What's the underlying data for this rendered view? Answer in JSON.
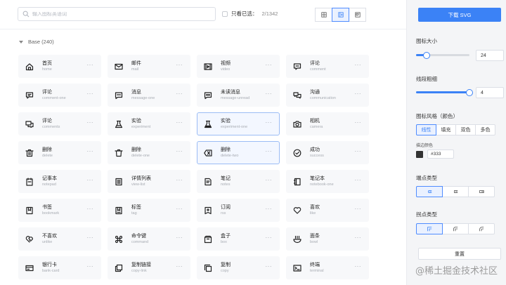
{
  "search": {
    "placeholder": "输入图标英语词"
  },
  "filter": {
    "only_selected_label": "只看已选：",
    "count": "2/1342"
  },
  "group": {
    "title": "Base (240)"
  },
  "icons": [
    {
      "zh": "首页",
      "en": "home",
      "icon": "home-icon",
      "highlight": false
    },
    {
      "zh": "邮件",
      "en": "mail",
      "icon": "mail-icon",
      "highlight": false
    },
    {
      "zh": "视频",
      "en": "video",
      "icon": "video-icon",
      "highlight": false
    },
    {
      "zh": "评论",
      "en": "comment",
      "icon": "comment-icon",
      "highlight": false
    },
    {
      "zh": "评论",
      "en": "comment-one",
      "icon": "comment-one-icon",
      "highlight": false
    },
    {
      "zh": "消息",
      "en": "message-one",
      "icon": "message-one-icon",
      "highlight": false
    },
    {
      "zh": "未读消息",
      "en": "message-unread",
      "icon": "message-unread-icon",
      "highlight": false
    },
    {
      "zh": "沟通",
      "en": "communication",
      "icon": "communication-icon",
      "highlight": false
    },
    {
      "zh": "评论",
      "en": "comments",
      "icon": "comments-icon",
      "highlight": false
    },
    {
      "zh": "实验",
      "en": "experiment",
      "icon": "experiment-icon",
      "highlight": false
    },
    {
      "zh": "实验",
      "en": "experiment-one",
      "icon": "experiment-one-icon",
      "highlight": true
    },
    {
      "zh": "相机",
      "en": "camera",
      "icon": "camera-icon",
      "highlight": false
    },
    {
      "zh": "删除",
      "en": "delete",
      "icon": "delete-icon",
      "highlight": false
    },
    {
      "zh": "删除",
      "en": "delete-one",
      "icon": "delete-one-icon",
      "highlight": false
    },
    {
      "zh": "删除",
      "en": "delete-two",
      "icon": "delete-two-icon",
      "highlight": true
    },
    {
      "zh": "成功",
      "en": "success",
      "icon": "success-icon",
      "highlight": false
    },
    {
      "zh": "记事本",
      "en": "notepad",
      "icon": "notepad-icon",
      "highlight": false
    },
    {
      "zh": "详情列表",
      "en": "view-list",
      "icon": "view-list-icon",
      "highlight": false
    },
    {
      "zh": "笔记",
      "en": "notes",
      "icon": "notes-icon",
      "highlight": false
    },
    {
      "zh": "笔记本",
      "en": "notebook-one",
      "icon": "notebook-one-icon",
      "highlight": false
    },
    {
      "zh": "书签",
      "en": "bookmark",
      "icon": "bookmark-icon",
      "highlight": false
    },
    {
      "zh": "标签",
      "en": "tag",
      "icon": "tag-icon",
      "highlight": false
    },
    {
      "zh": "订阅",
      "en": "rss",
      "icon": "rss-icon",
      "highlight": false
    },
    {
      "zh": "喜欢",
      "en": "like",
      "icon": "like-icon",
      "highlight": false
    },
    {
      "zh": "不喜欢",
      "en": "unlike",
      "icon": "unlike-icon",
      "highlight": false
    },
    {
      "zh": "命令键",
      "en": "command",
      "icon": "command-icon",
      "highlight": false
    },
    {
      "zh": "盒子",
      "en": "box",
      "icon": "box-icon",
      "highlight": false
    },
    {
      "zh": "面条",
      "en": "bowl",
      "icon": "bowl-icon",
      "highlight": false
    },
    {
      "zh": "银行卡",
      "en": "bank-card",
      "icon": "bank-card-icon",
      "highlight": false
    },
    {
      "zh": "复制链接",
      "en": "copy-link",
      "icon": "copy-link-icon",
      "highlight": false
    },
    {
      "zh": "复制",
      "en": "copy",
      "icon": "copy-icon",
      "highlight": false
    },
    {
      "zh": "终端",
      "en": "terminal",
      "icon": "terminal-icon",
      "highlight": false
    }
  ],
  "more_label": "···",
  "panel": {
    "download_label": "下载 SVG",
    "size": {
      "label": "图标大小",
      "value": "24",
      "fraction": 0.2
    },
    "stroke": {
      "label": "线段粗细",
      "value": "4",
      "fraction": 1.0
    },
    "style": {
      "label": "图标风格（颜色）",
      "options": [
        "线性",
        "填充",
        "双色",
        "多色"
      ],
      "active": 0
    },
    "stroke_color": {
      "label": "描边颜色",
      "value": "#333",
      "swatch": "#333333"
    },
    "endpoint": {
      "label": "端点类型",
      "active": 0
    },
    "corner": {
      "label": "拐点类型",
      "active": 0
    },
    "reset_label": "重置"
  },
  "watermark": "@稀土掘金技术社区",
  "colors": {
    "accent": "#3b82f6",
    "accent_light": "#eaf1ff"
  }
}
